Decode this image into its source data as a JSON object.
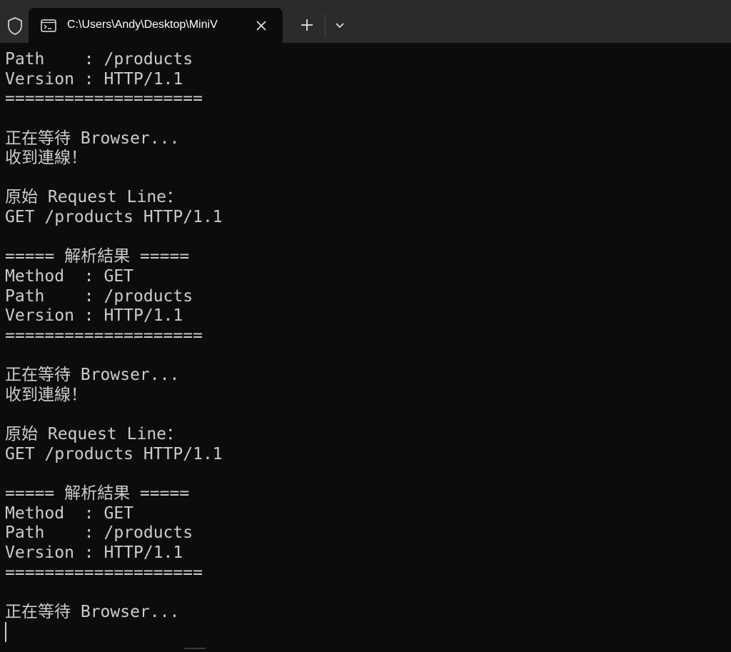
{
  "window": {
    "tab_title": "C:\\Users\\Andy\\Desktop\\MiniV",
    "tab_icon": "command-prompt-icon",
    "profile_icon": "shield-icon",
    "new_tab_icon": "plus-icon",
    "dropdown_icon": "chevron-down-icon",
    "close_icon": "close-icon"
  },
  "terminal": {
    "lines": [
      "Path    : /products",
      "Version : HTTP/1.1",
      "====================",
      "",
      "正在等待 Browser...",
      "收到連線！",
      "",
      "原始 Request Line：",
      "GET /products HTTP/1.1",
      "",
      "===== 解析結果 =====",
      "Method  : GET",
      "Path    : /products",
      "Version : HTTP/1.1",
      "====================",
      "",
      "正在等待 Browser...",
      "收到連線！",
      "",
      "原始 Request Line：",
      "GET /products HTTP/1.1",
      "",
      "===== 解析結果 =====",
      "Method  : GET",
      "Path    : /products",
      "Version : HTTP/1.1",
      "====================",
      "",
      "正在等待 Browser..."
    ]
  },
  "colors": {
    "background": "#0c0c0c",
    "titlebar": "#2b2b2b",
    "text": "#cccccc"
  }
}
